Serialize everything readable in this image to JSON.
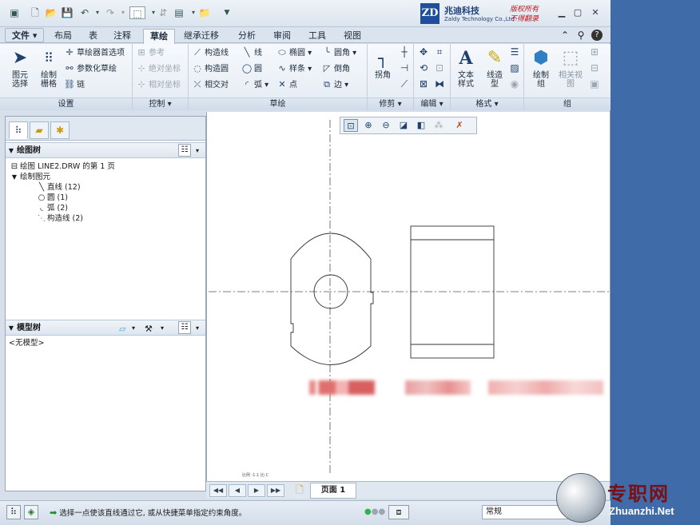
{
  "titlebar": {
    "logo_mark": "ZD",
    "logo_cn": "兆迪科技",
    "logo_en": "Zaldy Technology Co.,Ltd.",
    "logo_right_1": "版权所有",
    "logo_right_2": "不得翻录"
  },
  "tabs": {
    "file": "文件",
    "items": [
      "布局",
      "表",
      "注释",
      "草绘",
      "继承迁移",
      "分析",
      "审阅",
      "工具",
      "视图"
    ]
  },
  "ribbon": {
    "setup": {
      "label": "设置",
      "select": "图元\n选择",
      "grid": "绘制\n栅格",
      "sketch_pref": "草绘器首选项",
      "param_sketch": "参数化草绘",
      "chain": "链"
    },
    "control": {
      "label": "控制",
      "reference": "参考",
      "abs_coord": "绝对坐标",
      "rel_coord": "相对坐标"
    },
    "sketch": {
      "label": "草绘",
      "construction_line": "构造线",
      "construction_circle": "构造圆",
      "intersect": "相交对",
      "line": "线",
      "circle": "圆",
      "arc": "弧",
      "ellipse": "椭圆",
      "spline": "样条",
      "point": "点",
      "fillet": "圆角",
      "chamfer": "倒角",
      "edge": "边"
    },
    "modify": {
      "label": "修剪",
      "corner": "拐角"
    },
    "edit": {
      "label": "编辑"
    },
    "format": {
      "label": "格式",
      "text_style": "文本\n样式",
      "line_style": "线造\n型"
    },
    "group": {
      "label": "组",
      "draw_group": "绘制\n组",
      "related_view": "相关视\n图"
    }
  },
  "left_panel": {
    "drawing_tree": {
      "title": "绘图树",
      "root": "绘图 LINE2.DRW 的第 1 页",
      "folder": "绘制图元",
      "items": [
        "直线 (12)",
        "圆 (1)",
        "弧 (2)",
        "构造线 (2)"
      ]
    },
    "model_tree": {
      "title": "模型树",
      "empty": "<无模型>"
    }
  },
  "canvas": {
    "scale_text": "比例 :1:1   比:C"
  },
  "pagebar": {
    "page_label": "页面 1"
  },
  "statusbar": {
    "message": "选择一点使该直线通过它, 或从快捷菜单指定约束角度。",
    "filter": "常规"
  },
  "watermark": {
    "cn": "专职网",
    "en": "Zhuanzhi.Net"
  }
}
